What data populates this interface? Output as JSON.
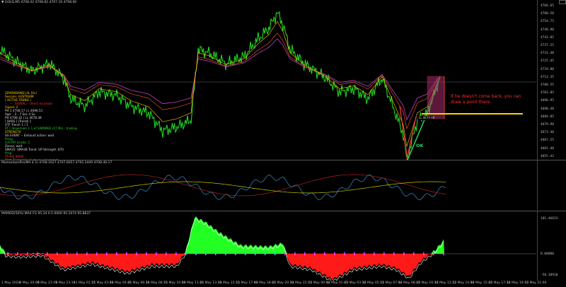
{
  "chart": {
    "main_header": "▼ GOLD,M5  4708.42 4708.82 4707.16 4708.90",
    "macd_header": "MomentumPro(MA 4.5) 4708.1627 4707.6057 4705.3449 4708.40.17",
    "osc_header": "MAMOD(50%) MA4 FG 95.24 0.5.0000 95.1674 95.8837",
    "price_scale": [
      "4766.65",
      "4760.50",
      "4754.75",
      "4748.90",
      "4743.05",
      "4737.25",
      "4731.40",
      "4725.45",
      "4719.80",
      "4713.35",
      "4708.55",
      "4703.05",
      "4696.95",
      "4690.48",
      "4684.85",
      "4679.98",
      "4673.40",
      "4667.55",
      "4661.48",
      "4655.42"
    ],
    "macd_scale": [
      "",
      "",
      "",
      "0.000000",
      "-0.000000"
    ],
    "osc_scale": [
      "101.46633",
      "",
      "0.00000",
      "-50.38910"
    ],
    "time_axis": [
      "1 May 2026",
      "8 May 20:00",
      "8 May 21:45",
      "8 May 23:30",
      "11 May 01:15",
      "11 May 03:00",
      "11 May 04:45",
      "11 May 06:30",
      "11 May 08:15",
      "11 May 10:00",
      "11 May 11:45",
      "11 May 13:30",
      "11 May 15:15",
      "11 May 17:00",
      "11 May 18:45",
      "11 May 20:30",
      "11 May 22:15",
      "12 May 00:00",
      "12 May 01:45",
      "12 May 03:30",
      "12 May 05:15",
      "12 May 07:00",
      "12 May 08:45",
      "12 May 10:30",
      "12 May 12:15",
      "12 May 14:00",
      "12 May 15:45",
      "12 May 17:30",
      "12 May 19:15",
      "12 May 21:00"
    ],
    "annotation": "If he doesn't come back, you can draw a point there.",
    "ok_label": "OK",
    "level_label": "LL 4679.90",
    "info_panel": [
      {
        "text": "[SPARKBAND] AL [0c]",
        "color": "#ffd000"
      },
      {
        "text": "Session: AUSTRIAM",
        "color": "#ffd000"
      },
      {
        "text": "[ ACTIVE TREND ]",
        "color": "#ffd000"
      },
      {
        "text": "-- . -- . SIGNAL -- direct no break",
        "color": "#ff3030"
      },
      {
        "text": "Signal: 2",
        "color": "#ffd000"
      },
      {
        "text": "PH 1  4708.17  |  L 4696.51",
        "color": "#dddddd"
      },
      {
        "text": "Age:  - 2 - 7 Sec 4 Sv",
        "color": "#dddddd"
      },
      {
        "text": "PH  4708.32  |  LL  4678.38",
        "color": "#dddddd"
      },
      {
        "text": "[ BARS ] (Trend) 1",
        "color": "#dddddd"
      },
      {
        "text": "VTF Trend: 1 / 1",
        "color": "#dddddd"
      },
      {
        "text": "RT [ dispersion ]: 1 of  SWRMED (17 ML) - trading",
        "color": "#28d428"
      },
      {
        "text": "STRENGTH",
        "color": "#ffd000"
      },
      {
        "text": "SG EVENT -- Exhaust action: wait",
        "color": "#dddddd"
      },
      {
        "text": "Proxy",
        "color": "#28d428"
      },
      {
        "text": "LUSTRY Grade: 2",
        "color": "#28d428"
      },
      {
        "text": "Zones: wait",
        "color": "#dddddd"
      },
      {
        "text": "SMA25: SMA38  Trend: UP  Strength: 870",
        "color": "#dddddd"
      },
      {
        "text": "Prop: ...",
        "color": "#28d428"
      },
      {
        "text": "TP-RSI WAVE",
        "color": "#ff3030"
      },
      {
        "text": "Hint: Expansion (just now incoming)",
        "color": "#ffd000"
      },
      {
        "text": "Pull is low: Breakdown before entry",
        "color": "#dddddd"
      },
      {
        "text": "Pullback Liquidity grab in progress",
        "color": "#dddddd"
      },
      {
        "text": "MANIPULATION",
        "color": "#ffd000"
      },
      {
        "text": "[ MARKETWAVE ]",
        "color": "#dddddd"
      },
      {
        "text": ">>> Daily/4 oil/pension <<<",
        "color": "#ffd000"
      }
    ],
    "colors": {
      "bull_candle": "#1fd61f",
      "bear_candle": "#1fd61f",
      "ma_fast": "#ffd000",
      "ma_mid": "#ff5a2d",
      "ma_slow": "#c040c0",
      "macd_line": "#3a8ecc",
      "signal_line": "#c8c800",
      "osc_pos": "#22ff22",
      "osc_neg": "#ff1a1a",
      "annotation": "#ff2b2b"
    }
  }
}
